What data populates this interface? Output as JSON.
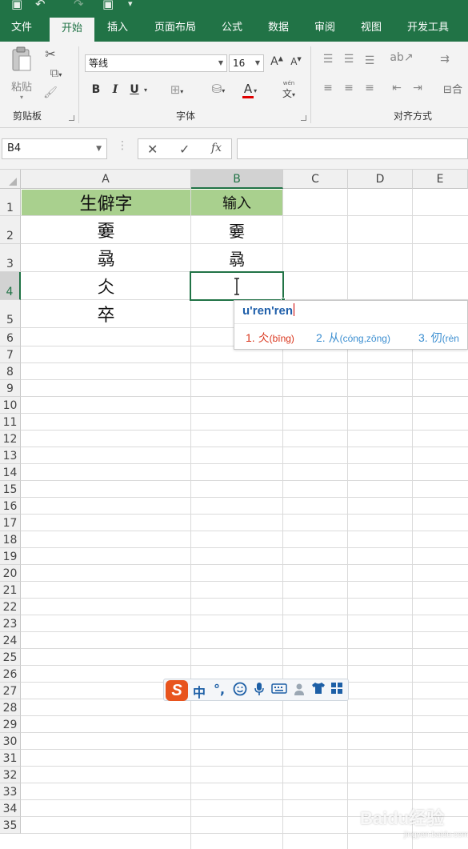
{
  "ribbon": {
    "tabs": [
      {
        "label": "文件",
        "active": false
      },
      {
        "label": "开始",
        "active": true
      },
      {
        "label": "插入",
        "active": false
      },
      {
        "label": "页面布局",
        "active": false
      },
      {
        "label": "公式",
        "active": false
      },
      {
        "label": "数据",
        "active": false
      },
      {
        "label": "审阅",
        "active": false
      },
      {
        "label": "视图",
        "active": false
      },
      {
        "label": "开发工具",
        "active": false
      }
    ],
    "clipboard": {
      "paste_label": "粘贴",
      "group_label": "剪贴板"
    },
    "font": {
      "font_name": "等线",
      "font_size": "16",
      "bold": "B",
      "italic": "I",
      "underline": "U",
      "wen": "文",
      "wen_pinyin": "wén",
      "group_label": "字体"
    },
    "alignment": {
      "group_label": "对齐方式",
      "merge_label": "合"
    },
    "accent_color": "#217346"
  },
  "formula_bar": {
    "name_box": "B4",
    "cancel_symbol": "✕",
    "enter_symbol": "✓",
    "fx_symbol": "fx",
    "value": ""
  },
  "sheet": {
    "columns": [
      "A",
      "B",
      "C",
      "D",
      "E"
    ],
    "selected_column": "B",
    "rows": [
      "1",
      "2",
      "3",
      "4",
      "5",
      "6",
      "7",
      "8",
      "9",
      "10",
      "11",
      "12",
      "13",
      "14",
      "15",
      "16",
      "17",
      "18",
      "19",
      "20",
      "21",
      "22",
      "23",
      "24",
      "25",
      "26",
      "27",
      "28",
      "29",
      "30",
      "31",
      "32",
      "33",
      "34",
      "35"
    ],
    "selected_row": "4",
    "header_fill": "#a9d08e",
    "cells": {
      "A1": "生僻字",
      "B1": "输入",
      "A2": "嫑",
      "B2": "嫑",
      "A3": "骉",
      "B3": "骉",
      "A4": "仌",
      "A5": "卒"
    },
    "active_cell": "B4"
  },
  "ime": {
    "composition": "u'ren'ren",
    "candidates": [
      {
        "label": "1. 仌",
        "pinyin": "(bīng)"
      },
      {
        "label": "2. 从",
        "pinyin": "(cóng,zōng)"
      },
      {
        "label": "3. 仞",
        "pinyin": "(rèn"
      }
    ],
    "first_color": "#d9331a",
    "other_color": "#3b8ed0"
  },
  "sogou_toolbar": {
    "logo": "S",
    "mode": "中",
    "punct": "°,",
    "smile_icon": "smile-icon",
    "mic_icon": "mic-icon",
    "keyboard_icon": "keyboard-icon",
    "user_icon": "user-icon",
    "skin_icon": "shirt-icon",
    "grid_icon": "grid-icon"
  },
  "watermark": {
    "text": "Baidu经验",
    "sub": "jingyan.baidu.com"
  }
}
